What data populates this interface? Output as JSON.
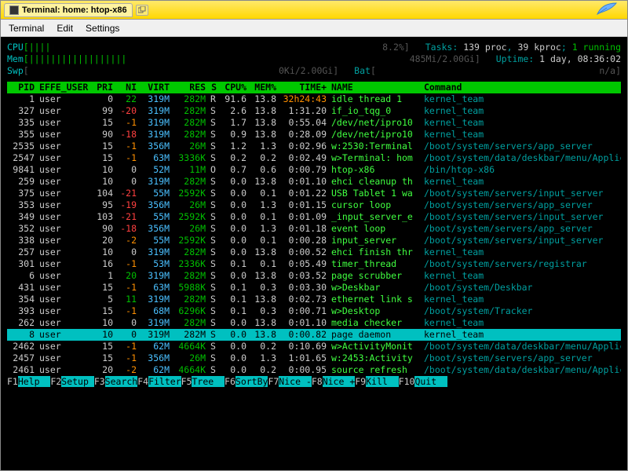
{
  "title": "Terminal: home: htop-x86",
  "menu": {
    "terminal": "Terminal",
    "edit": "Edit",
    "settings": "Settings"
  },
  "meters": {
    "cpu_label": "CPU",
    "cpu_bars": "[||||",
    "cpu_pct": "8.2%]",
    "mem_label": "Mem",
    "mem_bars": "[||||||||||||||||||",
    "mem_val": "485Mi/2.00Gi]",
    "swp_label": "Swp",
    "swp_bars": "[",
    "swp_val": "0Ki/2.00Gi]",
    "tasks_label": "Tasks:",
    "tasks_val": "139 proc, 39 kproc; 1 running",
    "uptime_label": "Uptime:",
    "uptime_val": "1 day, 08:36:02",
    "bat_label": "Bat",
    "bat_bars": "[",
    "bat_val": "n/a]"
  },
  "cols": [
    "PID",
    "EFFE_USER",
    "PRI",
    "NI",
    "VIRT",
    "RES",
    "S",
    "CPU%",
    "MEM%",
    "TIME+",
    "NAME",
    "Command"
  ],
  "rows": [
    {
      "pid": "1",
      "user": "user",
      "pri": "0",
      "ni": "22",
      "virt": "319M",
      "res": "282M",
      "s": "R",
      "cpu": "91.6",
      "mem": "13.8",
      "time": "32h24:43",
      "name": "idle thread 1",
      "cmd": "kernel_team"
    },
    {
      "pid": "327",
      "user": "user",
      "pri": "99",
      "ni": "-20",
      "virt": "319M",
      "res": "282M",
      "s": "S",
      "cpu": "2.6",
      "mem": "13.8",
      "time": "1:31.20",
      "name": "if_io_tqg_0",
      "cmd": "kernel_team"
    },
    {
      "pid": "335",
      "user": "user",
      "pri": "15",
      "ni": "-1",
      "virt": "319M",
      "res": "282M",
      "s": "S",
      "cpu": "1.7",
      "mem": "13.8",
      "time": "0:55.04",
      "name": "/dev/net/ipro10",
      "cmd": "kernel_team"
    },
    {
      "pid": "355",
      "user": "user",
      "pri": "90",
      "ni": "-18",
      "virt": "319M",
      "res": "282M",
      "s": "S",
      "cpu": "0.9",
      "mem": "13.8",
      "time": "0:28.09",
      "name": "/dev/net/ipro10",
      "cmd": "kernel_team"
    },
    {
      "pid": "2535",
      "user": "user",
      "pri": "15",
      "ni": "-1",
      "virt": "356M",
      "res": "26M",
      "s": "S",
      "cpu": "1.2",
      "mem": "1.3",
      "time": "0:02.96",
      "name": "w:2530:Terminal",
      "cmd": "/boot/system/servers/app_server"
    },
    {
      "pid": "2547",
      "user": "user",
      "pri": "15",
      "ni": "-1",
      "virt": "63M",
      "res": "3336K",
      "s": "S",
      "cpu": "0.2",
      "mem": "0.2",
      "time": "0:02.49",
      "name": "w>Terminal: hom",
      "cmd": "/boot/system/data/deskbar/menu/Applic"
    },
    {
      "pid": "9841",
      "user": "user",
      "pri": "10",
      "ni": "0",
      "virt": "52M",
      "res": "11M",
      "s": "O",
      "cpu": "0.7",
      "mem": "0.6",
      "time": "0:00.79",
      "name": "htop-x86",
      "cmd": "/bin/htop-x86"
    },
    {
      "pid": "259",
      "user": "user",
      "pri": "10",
      "ni": "0",
      "virt": "319M",
      "res": "282M",
      "s": "S",
      "cpu": "0.0",
      "mem": "13.8",
      "time": "0:01.10",
      "name": "ehci cleanup th",
      "cmd": "kernel_team"
    },
    {
      "pid": "375",
      "user": "user",
      "pri": "104",
      "ni": "-21",
      "virt": "55M",
      "res": "2592K",
      "s": "S",
      "cpu": "0.0",
      "mem": "0.1",
      "time": "0:01.22",
      "name": "USB Tablet 1 wa",
      "cmd": "/boot/system/servers/input_server"
    },
    {
      "pid": "353",
      "user": "user",
      "pri": "95",
      "ni": "-19",
      "virt": "356M",
      "res": "26M",
      "s": "S",
      "cpu": "0.0",
      "mem": "1.3",
      "time": "0:01.15",
      "name": "cursor loop",
      "cmd": "/boot/system/servers/app_server"
    },
    {
      "pid": "349",
      "user": "user",
      "pri": "103",
      "ni": "-21",
      "virt": "55M",
      "res": "2592K",
      "s": "S",
      "cpu": "0.0",
      "mem": "0.1",
      "time": "0:01.09",
      "name": "_input_server_e",
      "cmd": "/boot/system/servers/input_server"
    },
    {
      "pid": "352",
      "user": "user",
      "pri": "90",
      "ni": "-18",
      "virt": "356M",
      "res": "26M",
      "s": "S",
      "cpu": "0.0",
      "mem": "1.3",
      "time": "0:01.18",
      "name": "event loop",
      "cmd": "/boot/system/servers/app_server"
    },
    {
      "pid": "338",
      "user": "user",
      "pri": "20",
      "ni": "-2",
      "virt": "55M",
      "res": "2592K",
      "s": "S",
      "cpu": "0.0",
      "mem": "0.1",
      "time": "0:00.28",
      "name": "input_server",
      "cmd": "/boot/system/servers/input_server"
    },
    {
      "pid": "257",
      "user": "user",
      "pri": "10",
      "ni": "0",
      "virt": "319M",
      "res": "282M",
      "s": "S",
      "cpu": "0.0",
      "mem": "13.8",
      "time": "0:00.52",
      "name": "ehci finish thr",
      "cmd": "kernel_team"
    },
    {
      "pid": "301",
      "user": "user",
      "pri": "16",
      "ni": "-1",
      "virt": "53M",
      "res": "2336K",
      "s": "S",
      "cpu": "0.1",
      "mem": "0.1",
      "time": "0:05.49",
      "name": "timer_thread",
      "cmd": "/boot/system/servers/registrar"
    },
    {
      "pid": "6",
      "user": "user",
      "pri": "1",
      "ni": "20",
      "virt": "319M",
      "res": "282M",
      "s": "S",
      "cpu": "0.0",
      "mem": "13.8",
      "time": "0:03.52",
      "name": "page scrubber",
      "cmd": "kernel_team"
    },
    {
      "pid": "431",
      "user": "user",
      "pri": "15",
      "ni": "-1",
      "virt": "63M",
      "res": "5988K",
      "s": "S",
      "cpu": "0.1",
      "mem": "0.3",
      "time": "0:03.30",
      "name": "w>Deskbar",
      "cmd": "/boot/system/Deskbar"
    },
    {
      "pid": "354",
      "user": "user",
      "pri": "5",
      "ni": "11",
      "virt": "319M",
      "res": "282M",
      "s": "S",
      "cpu": "0.1",
      "mem": "13.8",
      "time": "0:02.73",
      "name": "ethernet link s",
      "cmd": "kernel_team"
    },
    {
      "pid": "393",
      "user": "user",
      "pri": "15",
      "ni": "-1",
      "virt": "68M",
      "res": "6296K",
      "s": "S",
      "cpu": "0.1",
      "mem": "0.3",
      "time": "0:00.71",
      "name": "w>Desktop",
      "cmd": "/boot/system/Tracker"
    },
    {
      "pid": "262",
      "user": "user",
      "pri": "10",
      "ni": "0",
      "virt": "319M",
      "res": "282M",
      "s": "S",
      "cpu": "0.0",
      "mem": "13.8",
      "time": "0:01.10",
      "name": "media checker",
      "cmd": "kernel_team"
    },
    {
      "pid": "8",
      "user": "user",
      "pri": "10",
      "ni": "0",
      "virt": "319M",
      "res": "282M",
      "s": "S",
      "cpu": "0.0",
      "mem": "13.8",
      "time": "0:00.82",
      "name": "page daemon",
      "cmd": "kernel_team",
      "sel": true
    },
    {
      "pid": "2462",
      "user": "user",
      "pri": "15",
      "ni": "-1",
      "virt": "62M",
      "res": "4664K",
      "s": "S",
      "cpu": "0.0",
      "mem": "0.2",
      "time": "0:10.69",
      "name": "w>ActivityMonit",
      "cmd": "/boot/system/data/deskbar/menu/Applic"
    },
    {
      "pid": "2457",
      "user": "user",
      "pri": "15",
      "ni": "-1",
      "virt": "356M",
      "res": "26M",
      "s": "S",
      "cpu": "0.0",
      "mem": "1.3",
      "time": "1:01.65",
      "name": "w:2453:Activity",
      "cmd": "/boot/system/servers/app_server"
    },
    {
      "pid": "2461",
      "user": "user",
      "pri": "20",
      "ni": "-2",
      "virt": "62M",
      "res": "4664K",
      "s": "S",
      "cpu": "0.0",
      "mem": "0.2",
      "time": "0:00.95",
      "name": "source refresh",
      "cmd": "/boot/system/data/deskbar/menu/Applic"
    }
  ],
  "fkeys": [
    [
      "F1",
      "Help"
    ],
    [
      "F2",
      "Setup"
    ],
    [
      "F3",
      "Search"
    ],
    [
      "F4",
      "Filter"
    ],
    [
      "F5",
      "Tree"
    ],
    [
      "F6",
      "SortBy"
    ],
    [
      "F7",
      "Nice -"
    ],
    [
      "F8",
      "Nice +"
    ],
    [
      "F9",
      "Kill"
    ],
    [
      "F10",
      "Quit"
    ]
  ]
}
